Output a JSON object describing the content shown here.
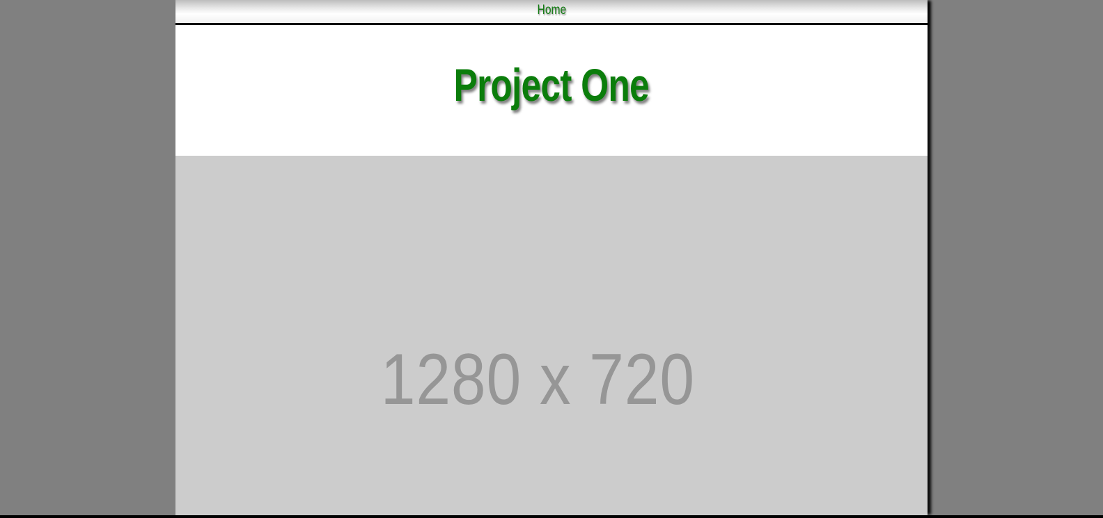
{
  "nav": {
    "home_label": "Home"
  },
  "header": {
    "title": "Project One"
  },
  "hero": {
    "placeholder_text": "1280 x 720"
  },
  "colors": {
    "background": "#808080",
    "page": "#ffffff",
    "accent_green": "#0b7d0b",
    "placeholder_bg": "#cccccc",
    "placeholder_text": "#969696"
  }
}
